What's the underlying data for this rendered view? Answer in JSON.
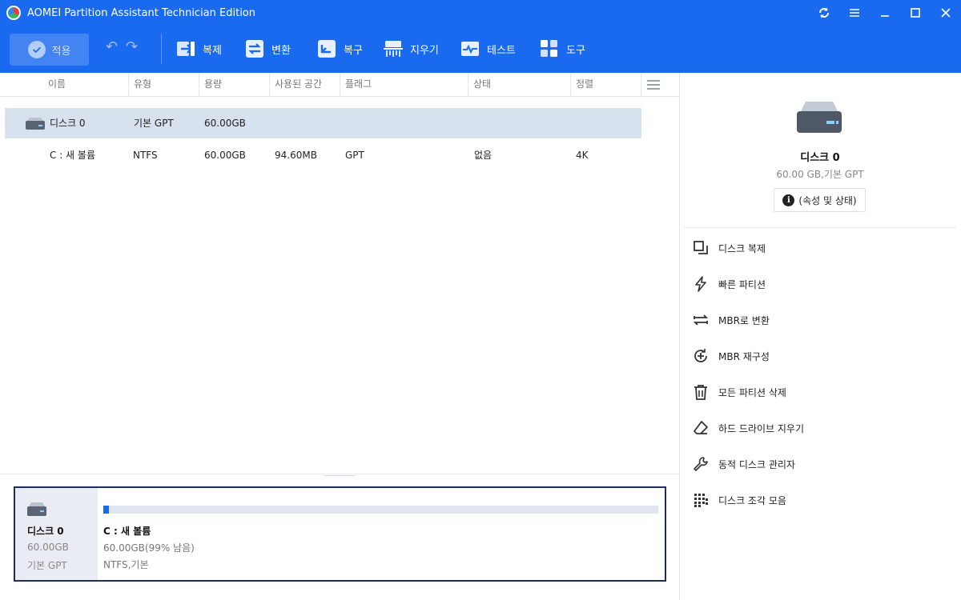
{
  "window": {
    "title": "AOMEI Partition Assistant Technician Edition"
  },
  "toolbar": {
    "apply": "적용",
    "items": [
      "복제",
      "변환",
      "복구",
      "지우기",
      "테스트",
      "도구"
    ]
  },
  "table": {
    "headers": [
      "이름",
      "유형",
      "용량",
      "사용된 공간",
      "플래그",
      "상태",
      "정렬"
    ],
    "rows": [
      {
        "name": "디스크 0",
        "type": "기본 GPT",
        "capacity": "60.00GB",
        "used": "",
        "flag": "",
        "status": "",
        "align": "",
        "selected": true
      },
      {
        "name": "C : 새 볼륨",
        "type": "NTFS",
        "capacity": "60.00GB",
        "used": "94.60MB",
        "flag": "GPT",
        "status": "없음",
        "align": "4K",
        "selected": false
      }
    ]
  },
  "disk_panel": {
    "name": "디스크 0",
    "size": "60.00GB",
    "type": "기본 GPT",
    "partition": {
      "name": "C : 새 볼륨",
      "free": "60.00GB(99% 남음)",
      "fs": "NTFS,기본",
      "used_fraction": 0.01
    }
  },
  "side": {
    "title": "디스크 0",
    "subtitle": "60.00 GB,기본 GPT",
    "props_button": "(속성 및 상태)",
    "operations": [
      {
        "label": "디스크 복제",
        "icon": "disk-clone-icon"
      },
      {
        "label": "빠른 파티션",
        "icon": "lightning-icon"
      },
      {
        "label": "MBR로 변환",
        "icon": "convert-icon"
      },
      {
        "label": "MBR 재구성",
        "icon": "rebuild-mbr-icon"
      },
      {
        "label": "모든 파티션 삭제",
        "icon": "trash-icon"
      },
      {
        "label": "하드 드라이브 지우기",
        "icon": "eraser-icon"
      },
      {
        "label": "동적 디스크 관리자",
        "icon": "wrench-icon"
      },
      {
        "label": "디스크 조각 모음",
        "icon": "defrag-icon"
      }
    ]
  },
  "colors": {
    "accent": "#1a6af0",
    "selected_row": "#d8e2ee",
    "card_border": "#1f2d5a"
  }
}
